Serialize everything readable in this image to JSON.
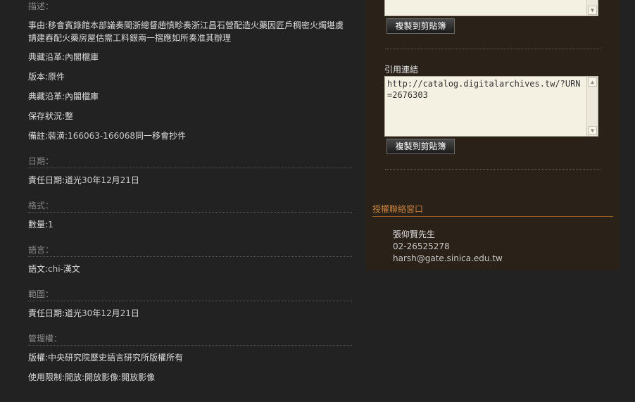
{
  "description": {
    "label": "描述：",
    "subject": "事由:移會賓錄館本部議奏閩浙總督趙慎畛奏浙江昌石營配造火藥因匠戶稠密火燭堪虞請建舂配火藥房屋估需工料銀兩一摺應如所奏准其辦理",
    "custody1": "典藏沿革:內閣檔庫",
    "version": "版本:原件",
    "custody2": "典藏沿革:內閣檔庫",
    "preservation": "保存狀況:整",
    "note_prefix": "備註:裝潢:",
    "note_range": "166063-166068",
    "note_suffix": "同一移會抄件"
  },
  "date": {
    "label": "日期：",
    "value_prefix": "責任日期:道光",
    "year": "30",
    "year_suffix": "年",
    "month": "12",
    "month_suffix": "月",
    "day": "21",
    "day_suffix": "日"
  },
  "format": {
    "label": "格式：",
    "value_prefix": "數量:",
    "value_num": "1"
  },
  "language": {
    "label": "語言：",
    "value_prefix": "語文:",
    "value_code": "chi-",
    "value_name": "漢文"
  },
  "coverage": {
    "label": "範圍：",
    "value_prefix": "責任日期:道光",
    "year": "30",
    "year_suffix": "年",
    "month": "12",
    "month_suffix": "月",
    "day": "21",
    "day_suffix": "日"
  },
  "rights": {
    "label": "管理權：",
    "copyright": "版權:中央研究院歷史語言研究所版權所有",
    "usage": "使用限制:開放:開放影像:開放影像"
  },
  "sidebar": {
    "copy_button_1": "複製到剪貼簿",
    "citation_label": "引用連結",
    "citation_url": "http://catalog.digitalarchives.tw/?URN=2676303",
    "copy_button_2": "複製到剪貼簿",
    "contact_title": "授權聯絡窗口",
    "contact_name": "張仰賢先生",
    "contact_phone": "02-26525278",
    "contact_email": "harsh@gate.sinica.edu.tw"
  },
  "colors": {
    "page_bg": "#222222",
    "panel_bg": "#2a2118",
    "accent": "#c8823e"
  }
}
